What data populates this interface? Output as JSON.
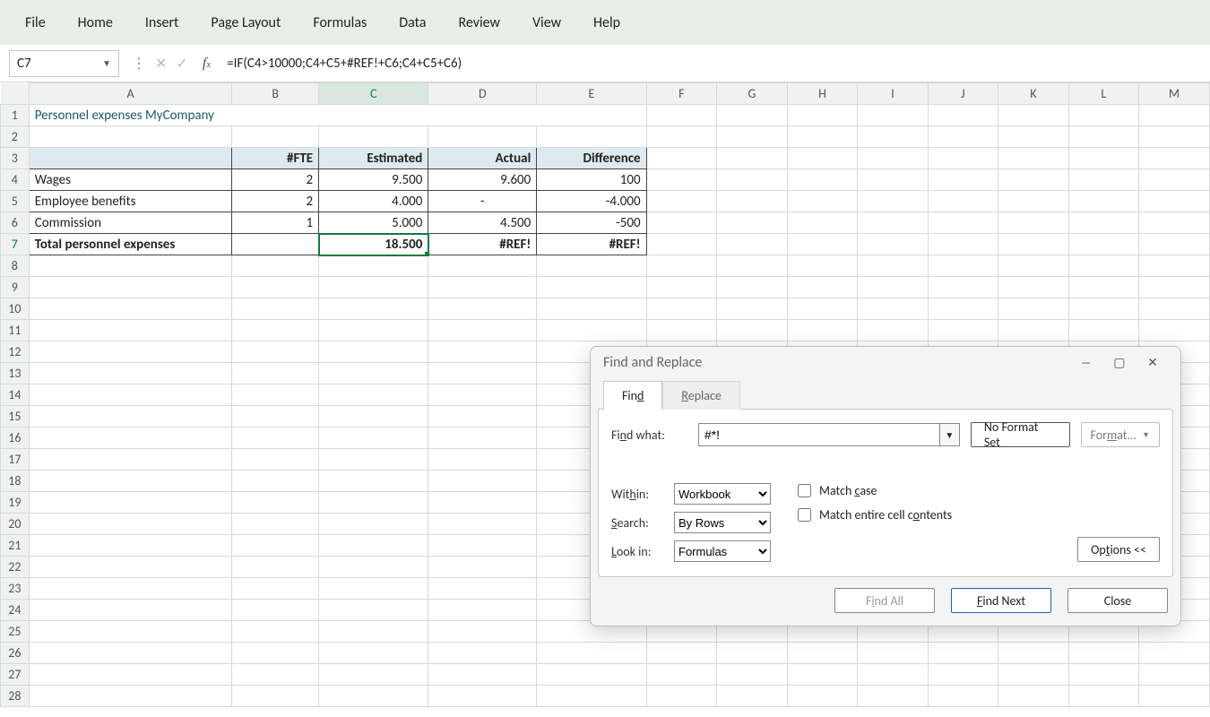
{
  "menu": [
    "File",
    "Home",
    "Insert",
    "Page Layout",
    "Formulas",
    "Data",
    "Review",
    "View",
    "Help"
  ],
  "namebox": "C7",
  "formula": "=IF(C4>10000;C4+C5+#REF!+C6;C4+C5+C6)",
  "columns": [
    "A",
    "B",
    "C",
    "D",
    "E",
    "F",
    "G",
    "H",
    "I",
    "J",
    "K",
    "L",
    "M"
  ],
  "row_count": 28,
  "title": "Personnel expenses MyCompany",
  "headers": {
    "a": "",
    "b": "#FTE",
    "c": "Estimated",
    "d": "Actual",
    "e": "Difference"
  },
  "rows": [
    {
      "a": "Wages",
      "b": "2",
      "c": "9.500",
      "d": "9.600",
      "e": "100"
    },
    {
      "a": "Employee benefits",
      "b": "2",
      "c": "4.000",
      "d": "-",
      "e": "-4.000"
    },
    {
      "a": "Commission",
      "b": "1",
      "c": "5.000",
      "d": "4.500",
      "e": "-500"
    }
  ],
  "total": {
    "a": "Total personnel expenses",
    "b": "",
    "c": "18.500",
    "d": "#REF!",
    "e": "#REF!"
  },
  "selected_cell": "C7",
  "dialog": {
    "title": "Find and Replace",
    "tab_find": "Find",
    "tab_find_u": "d",
    "tab_replace": "Replace",
    "tab_replace_u": "R",
    "find_what_label": "Find what:",
    "find_what_value": "#*!",
    "no_format": "No Format Set",
    "format_btn": "Format...",
    "within_label": "Within:",
    "within_value": "Workbook",
    "search_label": "Search:",
    "search_value": "By Rows",
    "lookin_label": "Look in:",
    "lookin_value": "Formulas",
    "match_case": "Match case",
    "match_contents": "Match entire cell contents",
    "options_btn": "Options <<",
    "find_all": "Find All",
    "find_next": "Find Next",
    "close": "Close"
  }
}
